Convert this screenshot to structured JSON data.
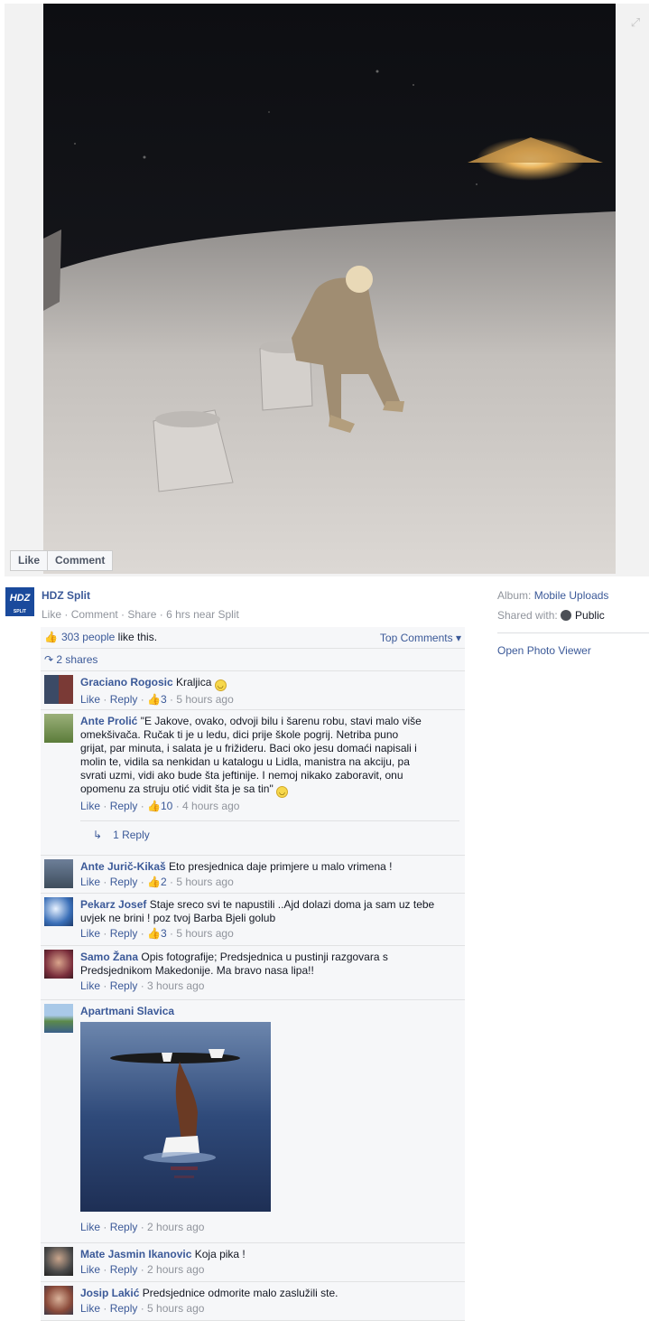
{
  "stage": {
    "like_button": "Like",
    "comment_button": "Comment",
    "expand_icon": "expand-icon"
  },
  "post": {
    "page_name": "HDZ Split",
    "avatar_text": "HDZ",
    "avatar_subtext": "SPLIT",
    "action_like": "Like",
    "action_comment": "Comment",
    "action_share": "Share",
    "meta": "6 hrs near Split",
    "separator": " · "
  },
  "right": {
    "album_label": "Album:",
    "album_value": "Mobile Uploads",
    "shared_label": "Shared with:",
    "shared_value": "Public",
    "open_viewer": "Open Photo Viewer"
  },
  "feedback": {
    "likes_count": "303 people",
    "likes_suffix": " like this.",
    "top_comments": "Top Comments",
    "shares": "2 shares"
  },
  "comments": [
    {
      "name": "Graciano Rogosic",
      "text": "Kraljica",
      "like": "Like",
      "reply": "Reply",
      "likes": "3",
      "time": "5 hours ago"
    },
    {
      "name": "Ante Prolić",
      "text": "\"E Jakove, ovako, odvoji bilu i šarenu robu, stavi malo više omekšivača. Ručak ti je u ledu, dici prije škole pogrij. Netriba puno grijat, par minuta, i salata je u frižideru. Baci oko jesu domaći napisali i molin te, vidila sa nenkidan u katalogu u Lidla, manistra na akciju, pa svrati uzmi, vidi ako bude šta jeftinije. I nemoj nikako zaboravit, onu opomenu za struju otić vidit šta je sa tin\"",
      "like": "Like",
      "reply": "Reply",
      "likes": "10",
      "time": "4 hours ago",
      "replies_link": "1 Reply"
    },
    {
      "name": "Ante Jurič-Kikaš",
      "text": "Eto presjednica daje primjere u malo vrimena !",
      "like": "Like",
      "reply": "Reply",
      "likes": "2",
      "time": "5 hours ago"
    },
    {
      "name": "Pekarz Josef",
      "text": "Staje sreco svi te napustili ..Ajd dolazi doma ja sam uz tebe uvjek ne brini ! poz tvoj Barba Bjeli golub",
      "like": "Like",
      "reply": "Reply",
      "likes": "3",
      "time": "5 hours ago"
    },
    {
      "name": "Samo Žana",
      "text": "Opis fotografije; Predsjednica u pustinji razgovara s Predsjednikom Makedonije. Ma bravo nasa lipa!!",
      "like": "Like",
      "reply": "Reply",
      "time": "3 hours ago"
    },
    {
      "name": "Apartmani Slavica",
      "text": "",
      "like": "Like",
      "reply": "Reply",
      "time": "2 hours ago"
    },
    {
      "name": "Mate Jasmin Ikanovic",
      "text": "Koja pika !",
      "like": "Like",
      "reply": "Reply",
      "time": "2 hours ago"
    },
    {
      "name": "Josip Lakić",
      "text": "Predsjednice odmorite malo zaslužili ste.",
      "like": "Like",
      "reply": "Reply",
      "time": "5 hours ago"
    }
  ]
}
